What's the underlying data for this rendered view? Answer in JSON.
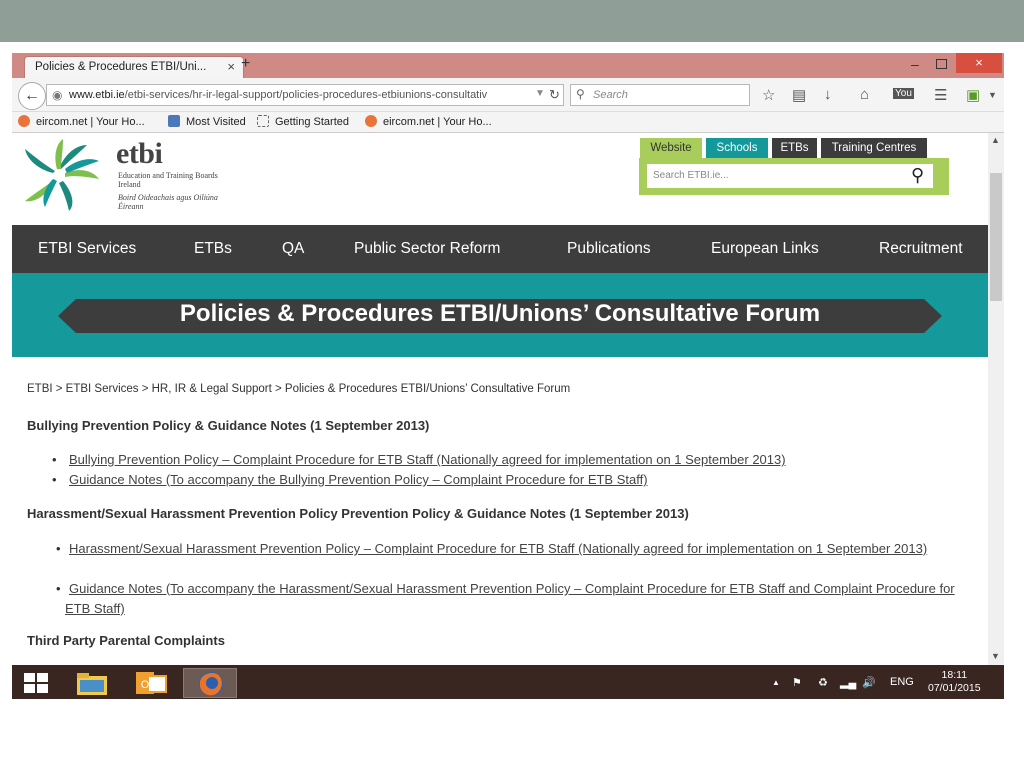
{
  "browser": {
    "tab_title": "Policies & Procedures ETBI/Uni...",
    "tab_close": "×",
    "new_tab": "+",
    "win_min": "–",
    "win_close": "×",
    "url_host": "www.etbi.ie",
    "url_path": "/etbi-services/hr-ir-legal-support/policies-procedures-etbiunions-consultativ",
    "search_placeholder": "Search",
    "bookmarks": [
      "eircom.net | Your Ho...",
      "Most Visited",
      "Getting Started",
      "eircom.net | Your Ho..."
    ]
  },
  "header": {
    "brand": "etbi",
    "brand_sub_en": "Education and Training Boards Ireland",
    "brand_sub_ga": "Boird Oideachais agus Oiliúna Éireann",
    "site_tabs": [
      "Website",
      "Schools",
      "ETBs",
      "Training Centres"
    ],
    "search_placeholder": "Search ETBI.ie..."
  },
  "nav": [
    "ETBI Services",
    "ETBs",
    "QA",
    "Public Sector Reform",
    "Publications",
    "European Links",
    "Recruitment"
  ],
  "banner": {
    "title": "Policies & Procedures ETBI/Unions’ Consultative Forum"
  },
  "content": {
    "breadcrumb": "ETBI > ETBI Services > HR, IR & Legal Support > Policies & Procedures ETBI/Unions’ Consultative Forum",
    "sections": [
      {
        "heading": "Bullying Prevention Policy & Guidance Notes (1 September 2013)",
        "links": [
          "Bullying Prevention Policy – Complaint Procedure for ETB Staff (Nationally agreed for implementation on 1 September 2013)",
          "Guidance Notes (To accompany the Bullying Prevention Policy – Complaint Procedure for ETB Staff)"
        ]
      },
      {
        "heading": "Harassment/Sexual Harassment Prevention Policy Prevention Policy & Guidance Notes (1 September 2013)",
        "links": [
          "Harassment/Sexual Harassment Prevention Policy – Complaint Procedure for ETB Staff (Nationally agreed for implementation on 1 September 2013)",
          "Guidance Notes (To accompany the Harassment/Sexual Harassment Prevention Policy – Complaint Procedure for ETB Staff and Complaint Procedure for ETB Staff)"
        ]
      },
      {
        "heading": "Third Party Parental Complaints",
        "links": []
      }
    ]
  },
  "taskbar": {
    "language": "ENG",
    "time": "18:11",
    "date": "07/01/2015"
  },
  "colors": {
    "teal": "#15999a",
    "green": "#a9cd5a",
    "nav_dark": "#3d3d3d",
    "titlebar": "#d08a86"
  }
}
